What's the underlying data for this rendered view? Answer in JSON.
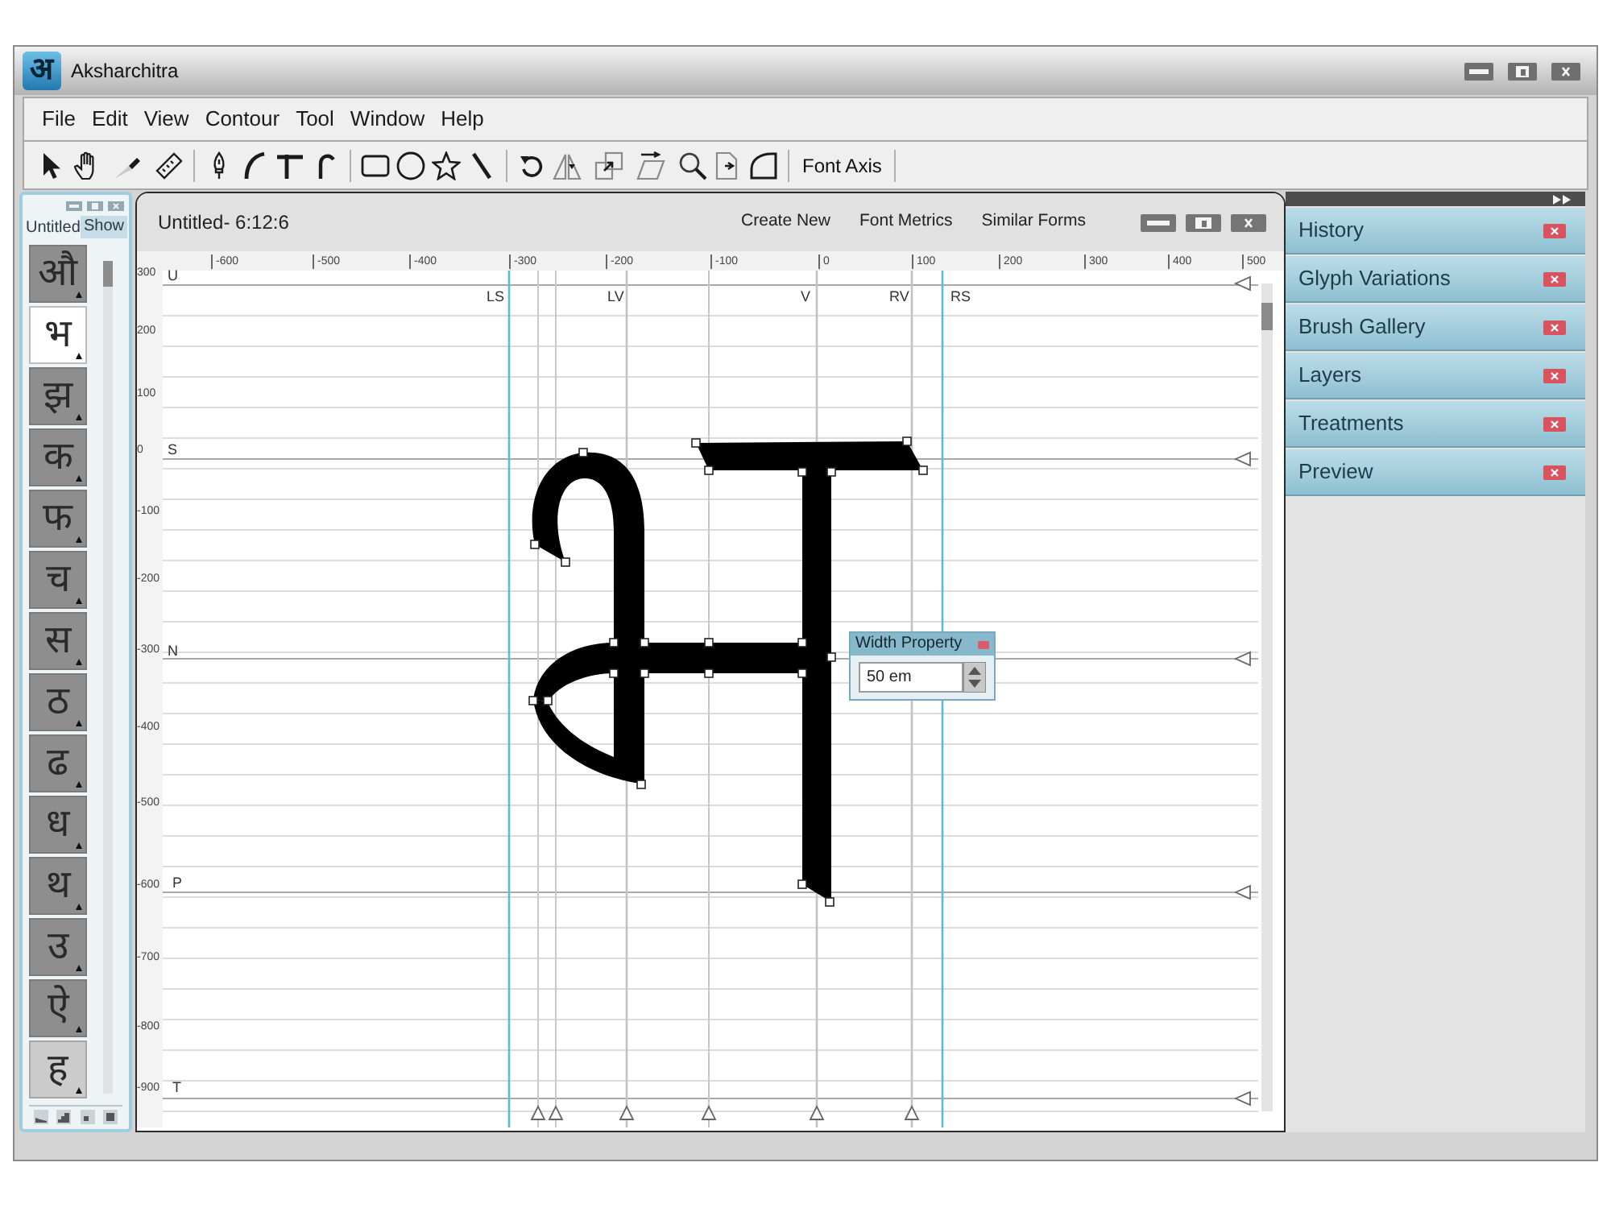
{
  "window": {
    "logo": "अ",
    "title": "Aksharchitra"
  },
  "menu": [
    "File",
    "Edit",
    "View",
    "Contour",
    "Tool",
    "Window",
    "Help"
  ],
  "toolbar": {
    "button": "Font Axis"
  },
  "glyph_panel": {
    "title": "Untitled",
    "toggle": "Show",
    "glyphs": [
      {
        "char": "औ",
        "selected": false,
        "hovered": false
      },
      {
        "char": "भ",
        "selected": true,
        "hovered": false
      },
      {
        "char": "झ",
        "selected": false,
        "hovered": false
      },
      {
        "char": "क",
        "selected": false,
        "hovered": false
      },
      {
        "char": "फ",
        "selected": false,
        "hovered": false
      },
      {
        "char": "च",
        "selected": false,
        "hovered": false
      },
      {
        "char": "स",
        "selected": false,
        "hovered": false
      },
      {
        "char": "ठ",
        "selected": false,
        "hovered": false
      },
      {
        "char": "ढ",
        "selected": false,
        "hovered": false
      },
      {
        "char": "ध",
        "selected": false,
        "hovered": false
      },
      {
        "char": "थ",
        "selected": false,
        "hovered": false
      },
      {
        "char": "उ",
        "selected": false,
        "hovered": false
      },
      {
        "char": "ऐ",
        "selected": false,
        "hovered": false
      },
      {
        "char": "ह",
        "selected": false,
        "hovered": true
      }
    ]
  },
  "editor": {
    "title": "Untitled- 6:12:6",
    "menu": [
      "Create New",
      "Font Metrics",
      "Similar Forms"
    ],
    "x_ruler": [
      "-600",
      "-500",
      "-400",
      "-300",
      "-200",
      "-100",
      "0",
      "100",
      "200",
      "300",
      "400",
      "500"
    ],
    "y_ruler": [
      "300",
      "200",
      "100",
      "0",
      "-100",
      "-200",
      "-300",
      "-400",
      "-500",
      "-600",
      "-700",
      "-800",
      "-900"
    ],
    "metric_lines": [
      "U",
      "S",
      "N",
      "P",
      "T"
    ],
    "guides": [
      "LS",
      "LV",
      "V",
      "RV",
      "RS"
    ],
    "width_property": {
      "title": "Width Property",
      "value": "50 em"
    }
  },
  "panels": [
    "History",
    "Glyph Variations",
    "Brush Gallery",
    "Layers",
    "Treatments",
    "Preview"
  ]
}
